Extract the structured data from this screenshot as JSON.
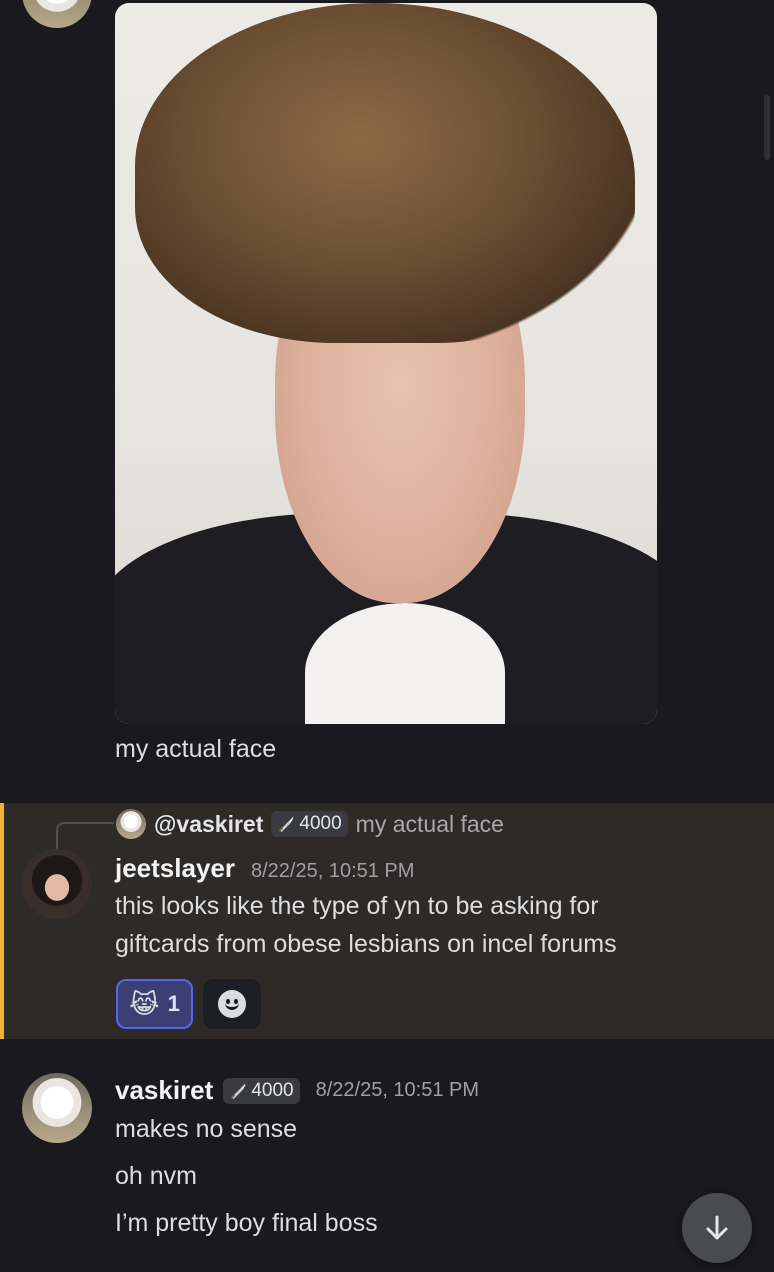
{
  "messages": {
    "top": {
      "caption": "my actual face"
    },
    "reply_message": {
      "reply_to": {
        "username": "@vaskiret",
        "tag_value": "4000",
        "snippet": "my actual face"
      },
      "author": "jeetslayer",
      "timestamp": "8/22/25, 10:51 PM",
      "lines": [
        "this looks like the type of yn to be asking for",
        "giftcards from obese lesbians on incel forums"
      ],
      "reactions": [
        {
          "emoji": "😹",
          "count": "1",
          "active": true
        },
        {
          "emoji": "add-reaction-icon"
        }
      ]
    },
    "bottom": {
      "author": "vaskiret",
      "tag_value": "4000",
      "timestamp": "8/22/25, 10:51 PM",
      "lines": [
        "makes no sense",
        "oh nvm",
        "I’m pretty boy final boss"
      ]
    }
  },
  "colors": {
    "background": "#1a1a1e",
    "highlight": "#2e2a27",
    "highlight_bar": "#f0b232",
    "reaction_active": "#3c3f73",
    "reaction_border": "#5865f2"
  }
}
